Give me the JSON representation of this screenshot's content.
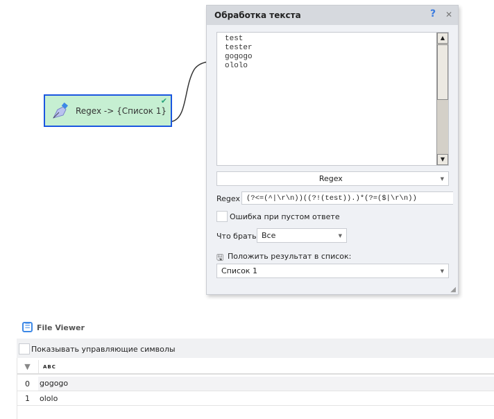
{
  "node": {
    "label": "Regex -> {Список 1}"
  },
  "panel": {
    "title": "Обработка текста",
    "help": "?",
    "close": "✕",
    "text_lines": [
      "test",
      "tester",
      "gogogo",
      "ololo"
    ],
    "mode": "Regex",
    "regex_label": "Regex",
    "regex_value": "(?<=(^|\\r\\n))((?!(test)).)*(?=($|\\r\\n))",
    "error_label": "Ошибка при пустом ответе",
    "take_label": "Что брать",
    "take_value": "Все",
    "save_label": "Положить результат в список:",
    "list_value": "Список 1"
  },
  "viewer": {
    "title": "File Viewer",
    "show_ctrl": "Показывать управляющие символы",
    "col_icon": "ABC",
    "rows": [
      {
        "i": "0",
        "v": "gogogo"
      },
      {
        "i": "1",
        "v": "ololo"
      }
    ]
  },
  "colors": {
    "accent": "#1a56e0",
    "node_bg": "#c6efd2",
    "check": "#27a37a"
  }
}
